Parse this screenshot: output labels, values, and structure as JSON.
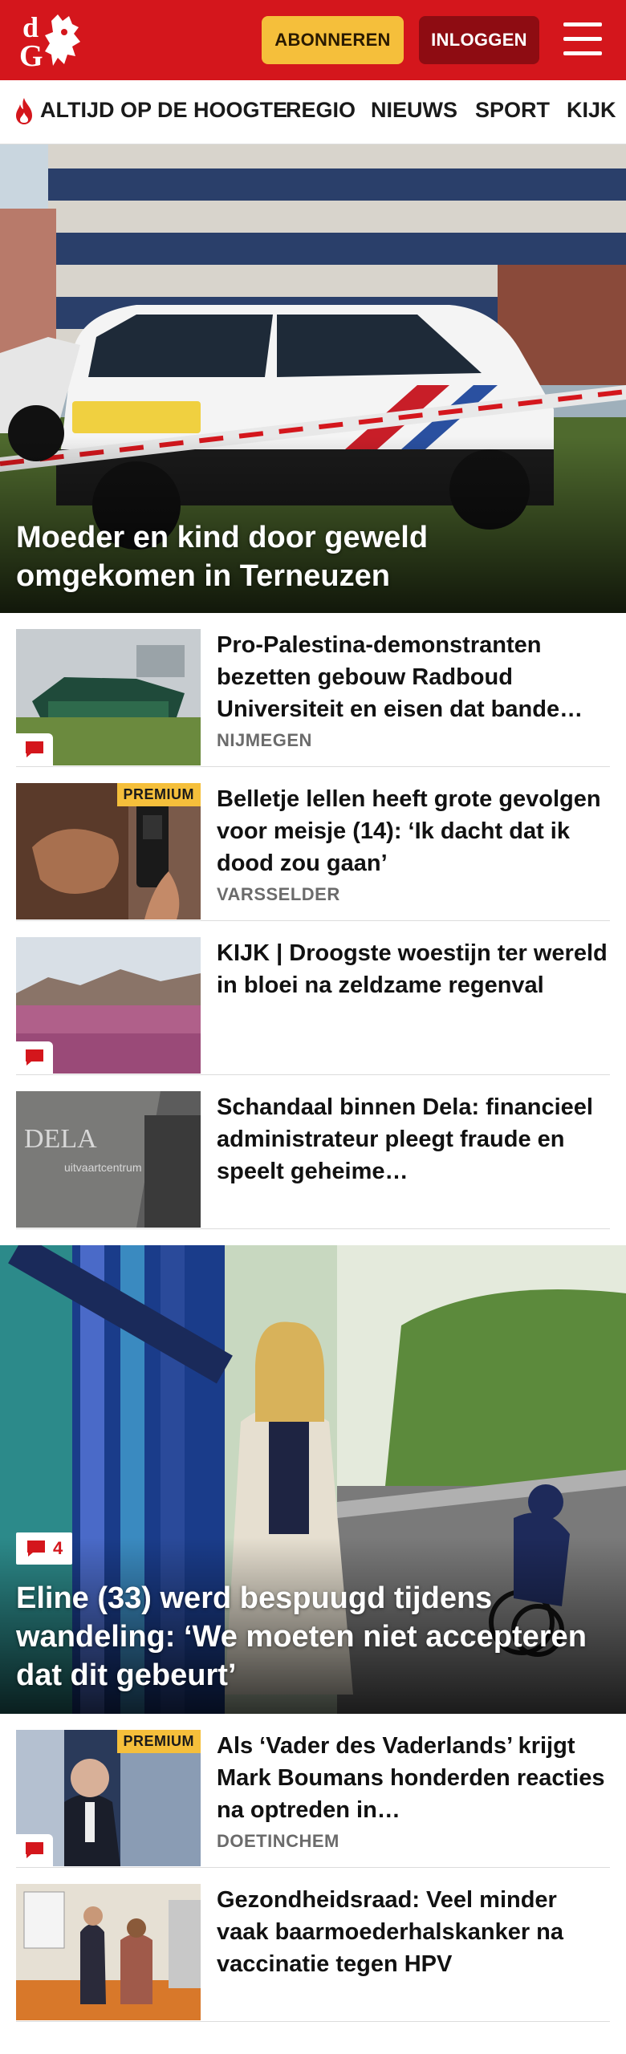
{
  "header": {
    "logo_alt": "dG",
    "subscribe_label": "ABONNEREN",
    "login_label": "INLOGGEN"
  },
  "nav": {
    "items": [
      "ALTIJD OP DE HOOGTE",
      "REGIO",
      "NIEUWS",
      "SPORT",
      "KIJK"
    ]
  },
  "hero1": {
    "title": "Moeder en kind door geweld omgekomen in Terneuzen"
  },
  "articles": [
    {
      "title": "Pro-Palestina-demonstranten bezetten gebouw Radboud Universiteit en eisen dat bande…",
      "location": "NIJMEGEN",
      "premium": false,
      "comments": true
    },
    {
      "title": "Belletje lellen heeft grote gevolgen voor meisje (14): ‘Ik dacht dat ik dood zou gaan’",
      "location": "VARSSELDER",
      "premium": true,
      "premium_label": "PREMIUM",
      "comments": false
    },
    {
      "title": "KIJK | Droogste woestijn ter wereld in bloei na zeldzame regenval",
      "location": "",
      "premium": false,
      "comments": true
    },
    {
      "title": "Schandaal binnen Dela: financieel administrateur pleegt fraude en speelt geheime…",
      "location": "",
      "premium": false,
      "comments": false
    }
  ],
  "hero2": {
    "title": "Eline (33) werd bespuugd tijdens wandeling: ‘We moeten niet accepteren dat dit gebeurt’",
    "comment_count": "4"
  },
  "articles2": [
    {
      "title": "Als ‘Vader des Vaderlands’ krijgt Mark Boumans honderden reacties na optreden in…",
      "location": "DOETINCHEM",
      "premium": true,
      "premium_label": "PREMIUM",
      "comments": true
    },
    {
      "title": "Gezondheidsraad: Veel minder vaak baarmoederhalskanker na vaccinatie tegen HPV",
      "location": "",
      "premium": false,
      "comments": false
    }
  ],
  "colors": {
    "brand_red": "#d4161c",
    "subscribe_yellow": "#f5bf3b",
    "login_dark_red": "#8e0c12"
  }
}
